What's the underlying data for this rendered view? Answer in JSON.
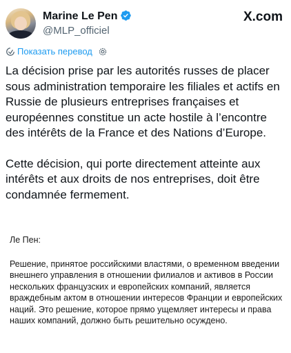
{
  "tweet": {
    "author": {
      "display_name": "Marine Le Pen",
      "handle": "@MLP_officiel",
      "verified": true
    },
    "platform_label": "X.com",
    "translate_link": "Показать перевод",
    "paragraphs": [
      "La décision prise par les autorités russes de placer sous administration temporaire les filiales et actifs en Russie de plusieurs entreprises françaises et européennes constitue un acte hostile à l’encontre des intérêts de la France et des Nations d’Europe.",
      "Cette décision, qui porte directement atteinte aux intérêts et aux droits de nos entreprises, doit être condamnée fermement."
    ]
  },
  "translation": {
    "lead": "Ле Пен:",
    "body": "Решение, принятое российскими властями, о временном введении внешнего управления в отношении филиалов и активов в России нескольких французских и европейских компаний, является враждебным актом в отношении интересов Франции и европейских наций. Это решение, которое прямо ущемляет интересы и права наших компаний, должно быть решительно осуждено."
  },
  "colors": {
    "verified_badge": "#1d9bf0",
    "link": "#1d9bf0",
    "secondary_text": "#536471",
    "text": "#0f1419"
  },
  "icons": {
    "verified": "verified-badge-icon",
    "translate": "translate-icon",
    "settings": "gear-icon",
    "brand": "x-logo-icon"
  }
}
